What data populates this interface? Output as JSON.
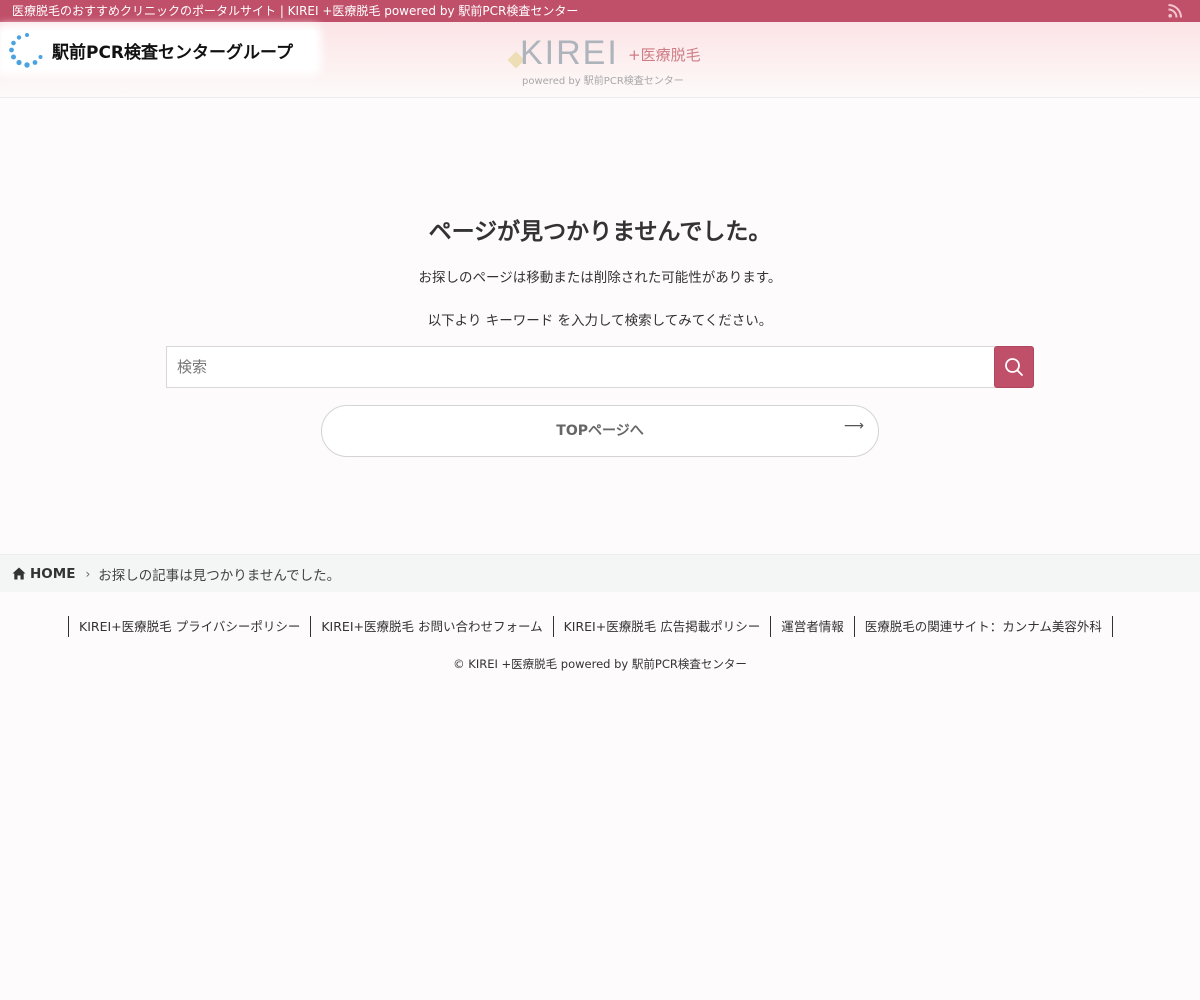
{
  "topbar": {
    "title": "医療脱毛のおすすめクリニックのポータルサイト | KIREI +医療脱毛 powered by 駅前PCR検査センター",
    "rss_icon": "rss-icon"
  },
  "header": {
    "group_logo_text": "駅前PCR検査センターグループ",
    "site_logo": {
      "main": "KIREI",
      "sub": "+医療脱毛",
      "powered": "powered by 駅前PCR検査センター"
    }
  },
  "main": {
    "title": "ページが見つかりませんでした。",
    "message1": "お探しのページは移動または削除された可能性があります。",
    "message2": "以下より キーワード を入力して検索してみてください。",
    "search": {
      "placeholder": "検索",
      "value": ""
    },
    "top_button_label": "TOPページへ",
    "top_button_arrow": "⟶"
  },
  "breadcrumb": {
    "home_label": "HOME",
    "separator": "›",
    "current": "お探しの記事は見つかりませんでした。"
  },
  "footer": {
    "links": [
      "KIREI+医療脱毛 プライバシーポリシー",
      "KIREI+医療脱毛 お問い合わせフォーム",
      "KIREI+医療脱毛 広告掲載ポリシー",
      "運営者情報",
      "医療脱毛の関連サイト：カンナム美容外科"
    ],
    "copyright": "© KIREI +医療脱毛 powered by 駅前PCR検査センター"
  },
  "colors": {
    "accent": "#c0506a",
    "logo_dots": "#4aa3df",
    "breadcrumb_bg": "#f4f5f5"
  }
}
